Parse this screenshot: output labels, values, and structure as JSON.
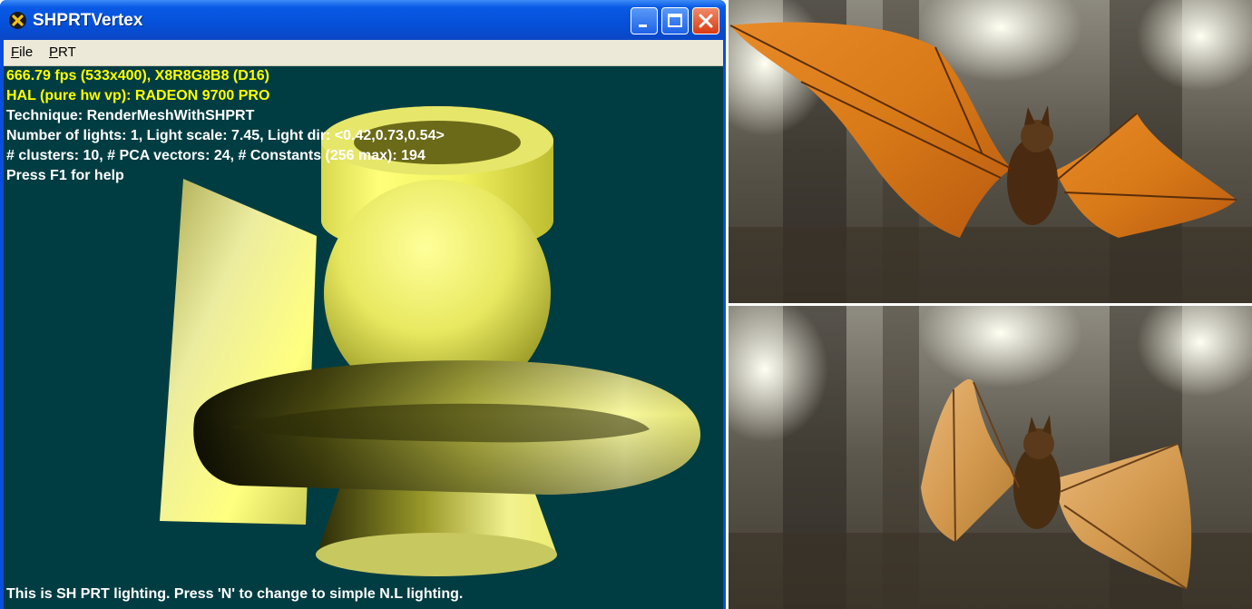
{
  "window": {
    "title": "SHPRTVertex",
    "title_icon": "directx-x-icon",
    "buttons": [
      "minimize-icon",
      "maximize-icon",
      "close-icon"
    ]
  },
  "menu": {
    "file": {
      "underline": "F",
      "rest": "ile"
    },
    "prt": {
      "underline": "P",
      "rest": "RT"
    }
  },
  "stats": {
    "line1": "666.79 fps (533x400), X8R8G8B8 (D16)",
    "line2": "HAL (pure hw vp): RADEON 9700 PRO",
    "line3": "Technique: RenderMeshWithSHPRT",
    "line4": "Number of lights: 1, Light scale: 7.45, Light dir: <0.42,0.73,0.54>",
    "line5": "# clusters: 10, # PCA vectors: 24, # Constants (256 max): 194",
    "line6": "Press F1 for help"
  },
  "footer": "This is SH PRT lighting.  Press 'N' to change to simple N.L lighting.",
  "colors": {
    "viewport_bg": "#003d42",
    "stat_highlight": "#ffff00",
    "stat_text": "#ffffff",
    "titlebar": "#0550d8"
  },
  "panels": [
    {
      "subject": "orange-bat-wings-spread",
      "background": "blurred-forest"
    },
    {
      "subject": "orange-bat-wings-raised",
      "background": "blurred-forest"
    }
  ]
}
